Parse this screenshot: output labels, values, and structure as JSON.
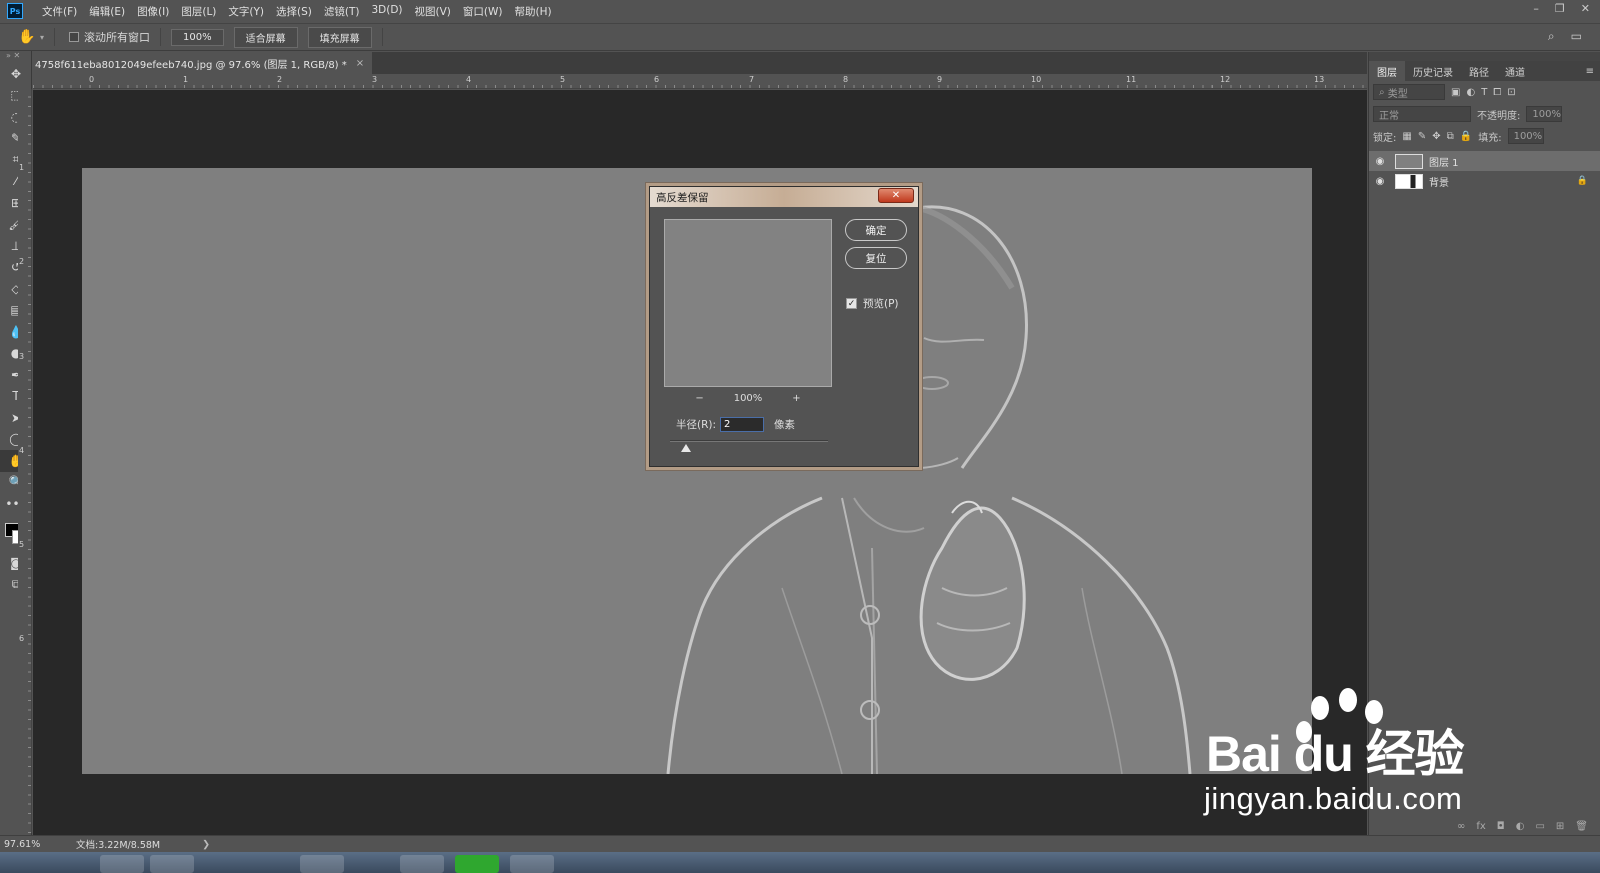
{
  "app": {
    "logo": "Ps"
  },
  "menu": [
    "文件(F)",
    "编辑(E)",
    "图像(I)",
    "图层(L)",
    "文字(Y)",
    "选择(S)",
    "滤镜(T)",
    "3D(D)",
    "视图(V)",
    "窗口(W)",
    "帮助(H)"
  ],
  "options": {
    "scroll_all_label": "滚动所有窗口",
    "zoom_btn": "100%",
    "fit_screen_btn": "适合屏幕",
    "fill_screen_btn": "填充屏幕"
  },
  "document": {
    "tab_title": "4758f611eba8012049efeeb740.jpg @ 97.6% (图层 1, RGB/8) *",
    "close": "×"
  },
  "ruler": {
    "h_ticks": [
      "0",
      "1",
      "2",
      "3",
      "4",
      "5",
      "6",
      "7",
      "8",
      "9",
      "10",
      "11",
      "12",
      "13"
    ],
    "v_ticks": [
      "1",
      "2",
      "3",
      "4",
      "5",
      "6"
    ]
  },
  "status": {
    "zoom": "97.61%",
    "doc_size": "文档:3.22M/8.58M",
    "arrow": "❯"
  },
  "panel": {
    "tabs": [
      "图层",
      "历史记录",
      "路径",
      "通道"
    ],
    "active_tab": 0,
    "filter_placeholder": "类型",
    "blend_mode": "正常",
    "opacity_label": "不透明度:",
    "opacity_value": "100%",
    "lock_label": "锁定:",
    "fill_label": "填充:",
    "fill_value": "100%",
    "layers": [
      {
        "name": "图层 1",
        "selected": true,
        "locked": false,
        "thumb_color": "#808080"
      },
      {
        "name": "背景",
        "selected": false,
        "locked": true,
        "thumb_color": "#ffffff"
      }
    ]
  },
  "dialog": {
    "title": "高反差保留",
    "close": "✕",
    "ok": "确定",
    "reset": "复位",
    "preview_label": "预览(P)",
    "preview_checked": true,
    "zoom_out": "−",
    "zoom_level": "100%",
    "zoom_in": "+",
    "radius_label": "半径(R):",
    "radius_value": "2",
    "radius_unit": "像素",
    "slider_fraction": 0.1
  },
  "watermark": {
    "logo": "Bai du 经验",
    "url": "jingyan.baidu.com"
  },
  "colors": {
    "accent": "#31a8ff",
    "canvas_gray": "#7f7f7f",
    "dialog_title": "#c6ad95"
  }
}
